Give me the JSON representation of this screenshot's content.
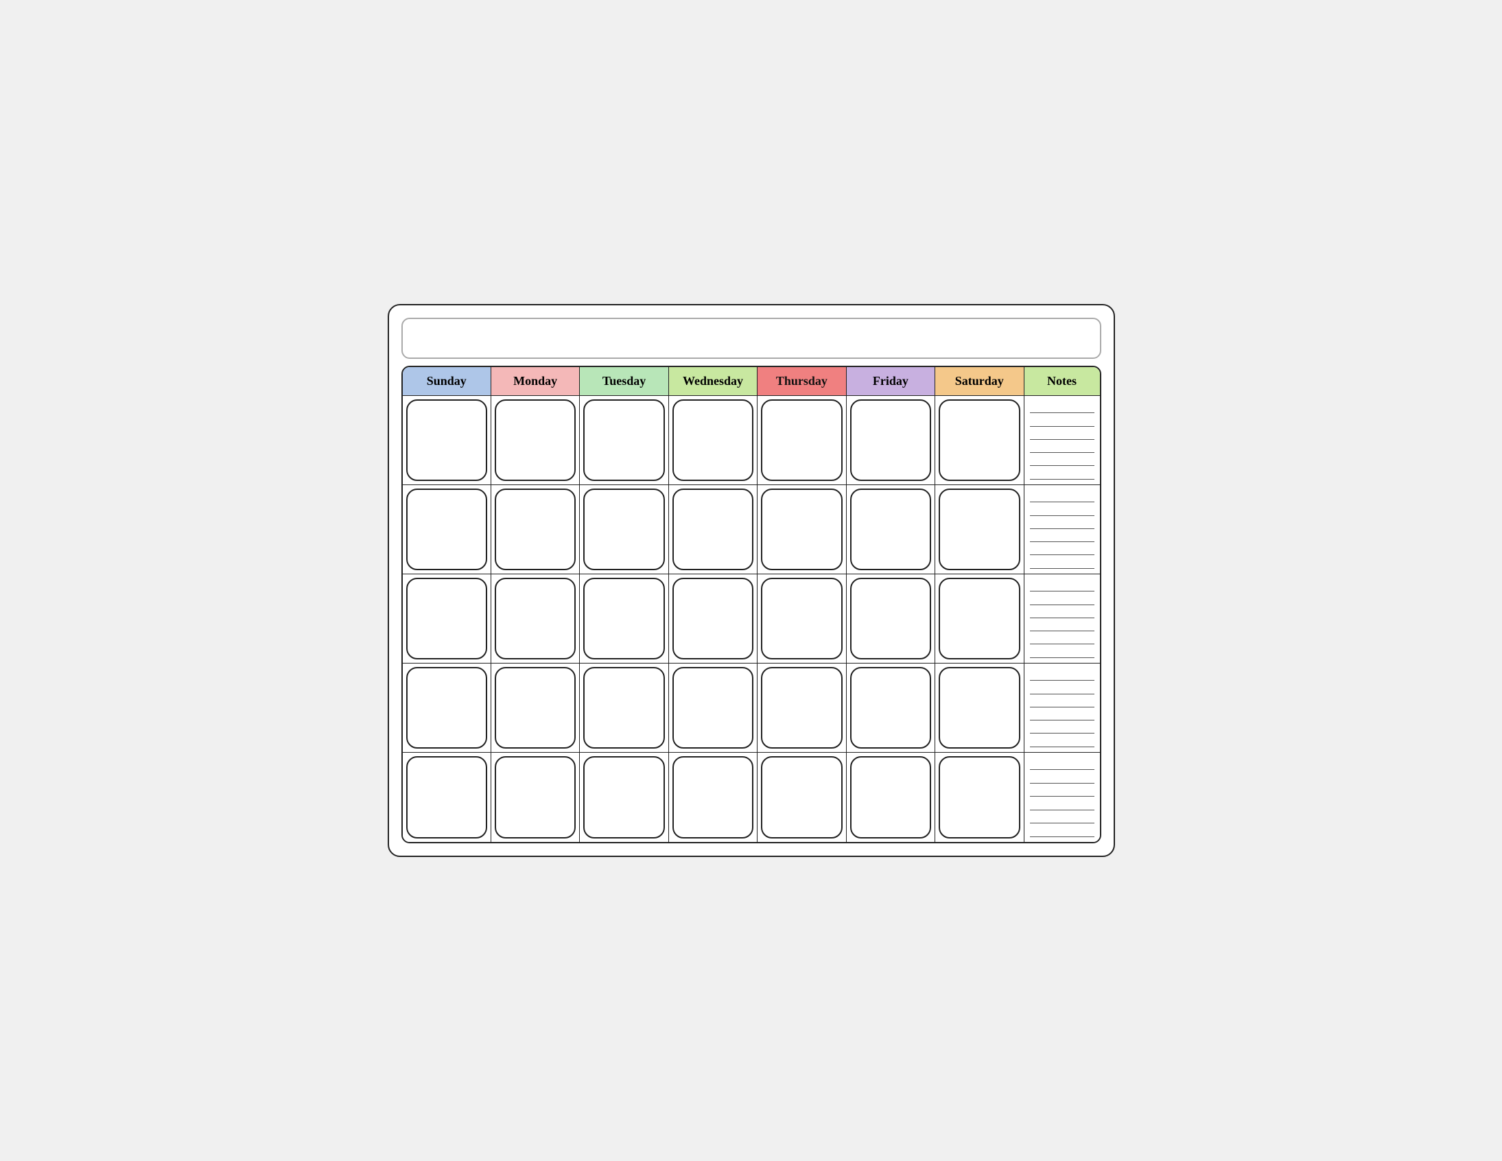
{
  "calendar": {
    "title": "",
    "days": [
      {
        "label": "Sunday",
        "class": "sunday"
      },
      {
        "label": "Monday",
        "class": "monday"
      },
      {
        "label": "Tuesday",
        "class": "tuesday"
      },
      {
        "label": "Wednesday",
        "class": "wednesday"
      },
      {
        "label": "Thursday",
        "class": "thursday"
      },
      {
        "label": "Friday",
        "class": "friday"
      },
      {
        "label": "Saturday",
        "class": "saturday"
      }
    ],
    "notes_label": "Notes",
    "rows": 5,
    "notes_lines": 30
  }
}
